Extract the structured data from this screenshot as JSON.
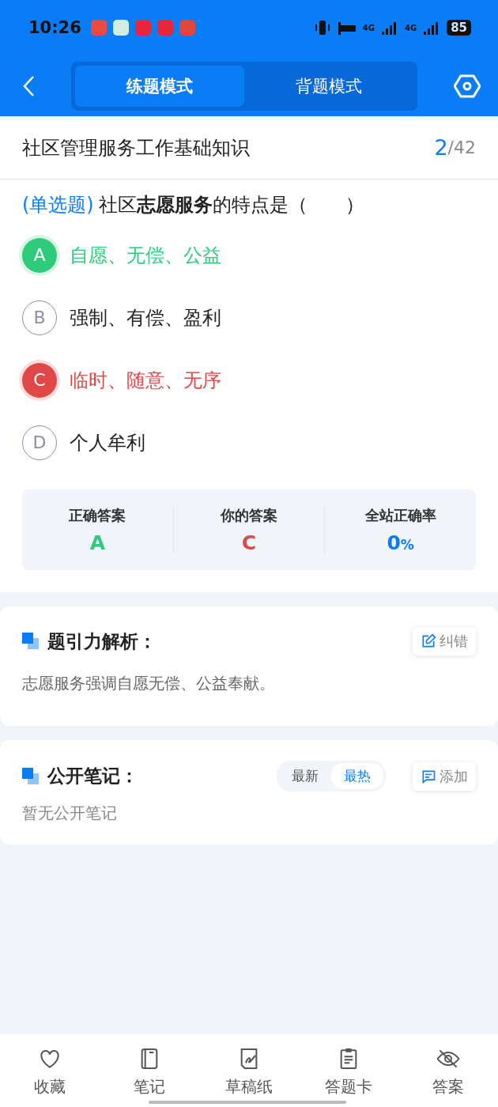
{
  "status_bar": {
    "time": "10:26",
    "notification_icons": [
      {
        "color": "#e94b43"
      },
      {
        "color": "#cfeee0"
      },
      {
        "color": "#e8283a"
      },
      {
        "color": "#e8283a"
      },
      {
        "color": "#e0463a"
      }
    ],
    "network": [
      "4G",
      "4G"
    ],
    "battery": "85"
  },
  "nav": {
    "modes": [
      {
        "label": "练题模式",
        "selected": true
      },
      {
        "label": "背题模式",
        "selected": false
      }
    ]
  },
  "header": {
    "title": "社区管理服务工作基础知识",
    "current": "2",
    "total": "/42"
  },
  "question": {
    "type": "(单选题)",
    "text": "社区**志愿服务**的特点是（　　）"
  },
  "options": [
    {
      "letter": "A",
      "text": "自愿、无偿、公益",
      "kind": "correct"
    },
    {
      "letter": "B",
      "text": "强制、有偿、盈利",
      "kind": "normal"
    },
    {
      "letter": "C",
      "text": "临时、随意、无序",
      "kind": "wrong"
    },
    {
      "letter": "D",
      "text": "个人牟利",
      "kind": "normal"
    }
  ],
  "stats": [
    {
      "label": "正确答案",
      "value": "A",
      "kind": "correct"
    },
    {
      "label": "你的答案",
      "value": "C",
      "kind": "wrong"
    },
    {
      "label": "全站正确率",
      "value": "0",
      "unit": "%",
      "kind": "rate"
    }
  ],
  "analysis": {
    "title": "题引力解析：",
    "action": "纠错",
    "text": "志愿服务强调自愿无偿、公益奉献。"
  },
  "notes": {
    "title": "公开笔记：",
    "sort_tabs": [
      {
        "label": "最新",
        "selected": false
      },
      {
        "label": "最热",
        "selected": true
      }
    ],
    "action": "添加",
    "empty": "暂无公开笔记"
  },
  "bottom_bar": [
    {
      "label": "收藏",
      "kind": "heart"
    },
    {
      "label": "笔记",
      "kind": "notebook"
    },
    {
      "label": "草稿纸",
      "kind": "draft"
    },
    {
      "label": "答题卡",
      "kind": "card"
    },
    {
      "label": "答案",
      "kind": "eye"
    }
  ]
}
